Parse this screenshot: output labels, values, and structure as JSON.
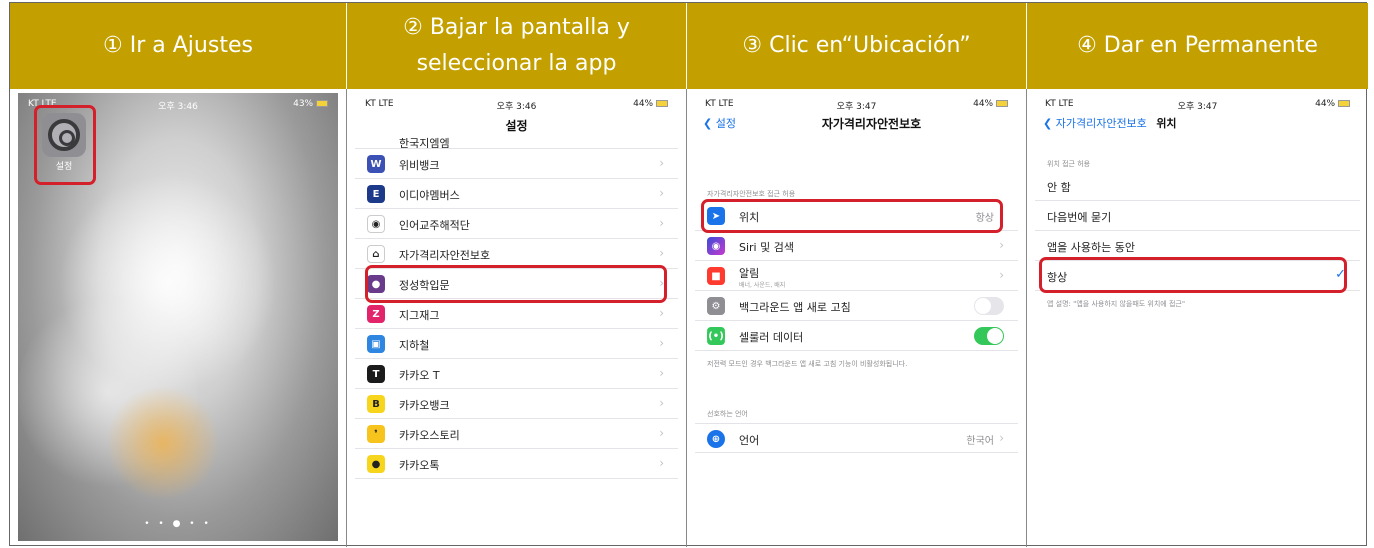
{
  "steps": [
    {
      "header": "① Ir a Ajustes"
    },
    {
      "header": "② Bajar la pantalla y seleccionar la app"
    },
    {
      "header": "③ Clic en“Ubicación”"
    },
    {
      "header": "④ Dar en Permanente"
    }
  ],
  "screen1": {
    "carrier": "KT  LTE",
    "time": "오후 3:46",
    "battery": "43%",
    "app_label": "설정",
    "page_dots": "• • ● • •"
  },
  "screen2": {
    "carrier": "KT  LTE",
    "time": "오후 3:46",
    "battery": "44%",
    "title": "설정",
    "cut_item": "한국지엠엠",
    "items": [
      {
        "label": "위비뱅크",
        "icon_text": "W",
        "icon_color": "#3b52b4"
      },
      {
        "label": "이디야멤버스",
        "icon_text": "E",
        "icon_color": "#1d3a8a"
      },
      {
        "label": "인어교주해적단",
        "icon_text": "◉",
        "icon_color": "#ffffff"
      },
      {
        "label": "자가격리자안전보호",
        "icon_text": "⌂",
        "icon_color": "#ffffff"
      },
      {
        "label": "정성학입문",
        "icon_text": "●",
        "icon_color": "#6a3b8a"
      },
      {
        "label": "지그재그",
        "icon_text": "Z",
        "icon_color": "#e2246b"
      },
      {
        "label": "지하철",
        "icon_text": "▣",
        "icon_color": "#2f86e0"
      },
      {
        "label": "카카오 T",
        "icon_text": "T",
        "icon_color": "#1b1b1b"
      },
      {
        "label": "카카오뱅크",
        "icon_text": "B",
        "icon_color": "#f7d51d"
      },
      {
        "label": "카카오스토리",
        "icon_text": "❜",
        "icon_color": "#f7c41d"
      },
      {
        "label": "카카오톡",
        "icon_text": "●",
        "icon_color": "#f7d51d"
      }
    ]
  },
  "screen3": {
    "carrier": "KT  LTE",
    "time": "오후 3:47",
    "battery": "44%",
    "back": "설정",
    "title": "자가격리자안전보호",
    "section1": "자가격리자안전보호 접근 허용",
    "location_label": "위치",
    "location_value": "항상",
    "siri_label": "Siri 및 검색",
    "notif_label": "알림",
    "notif_sub": "배너, 사운드, 배지",
    "bgrefresh_label": "백그라운드 앱 새로 고침",
    "cellular_label": "셀룰러 데이터",
    "footnote": "저전력 모드인 경우 백그라운드 앱 새로 고침 기능이 비활성화됩니다.",
    "section2": "선호하는 언어",
    "lang_label": "언어",
    "lang_value": "한국어"
  },
  "screen4": {
    "carrier": "KT  LTE",
    "time": "오후 3:47",
    "battery": "44%",
    "back": "자가격리자안전보호",
    "title": "위치",
    "section": "위치 접근 허용",
    "options": [
      "안 함",
      "다음번에 묻기",
      "앱을 사용하는 동안",
      "항상"
    ],
    "footnote": "앱 설명: \"앱을 사용하지 않을때도 위치에 접근\""
  },
  "colors": {
    "header_bg": "#c3a000",
    "highlight": "#d4202a",
    "ios_blue": "#1a73e8"
  }
}
